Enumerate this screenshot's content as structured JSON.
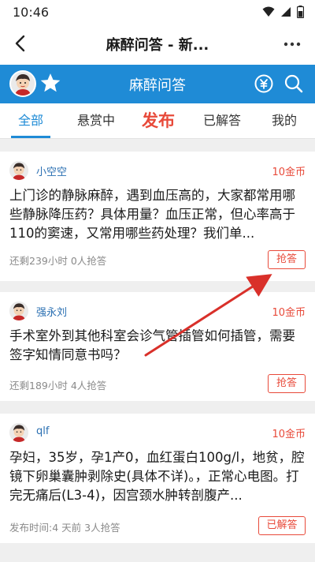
{
  "status_bar": {
    "time": "10:46"
  },
  "header": {
    "title": "麻醉问答 - 新..."
  },
  "app_bar": {
    "title": "麻醉问答"
  },
  "tabs": [
    {
      "label": "全部",
      "active": true
    },
    {
      "label": "悬赏中",
      "active": false
    },
    {
      "label": "发布",
      "active": false
    },
    {
      "label": "已解答",
      "active": false
    },
    {
      "label": "我的",
      "active": false
    }
  ],
  "questions": [
    {
      "user": "小空空",
      "reward": "10金币",
      "text": "上门诊的静脉麻醉，遇到血压高的，大家都常用哪些静脉降压药？具体用量？血压正常，但心率高于110的窦速，又常用哪些药处理？我们单...",
      "meta": "还剩239小时 0人抢答",
      "action": "抢答"
    },
    {
      "user": "强永刘",
      "reward": "10金币",
      "text": "手术室外到其他科室会诊气管插管如何插管，需要签字知情同意书吗？",
      "meta": "还剩189小时 4人抢答",
      "action": "抢答"
    },
    {
      "user": "qlf",
      "reward": "10金币",
      "text": "孕妇，35岁，孕1产0，血红蛋白100g/l，地贫，腔镜下卵巢囊肿剥除史(具体不详)。，正常心电图。打完无痛后(L3-4)，因宫颈水肿转剖腹产...",
      "meta": "发布时间:4 天前 3人抢答",
      "action": "已解答"
    }
  ],
  "colors": {
    "brand_blue": "#1f8bd6",
    "accent_red": "#e84a3a",
    "annotation_arrow": "#d9302a"
  }
}
